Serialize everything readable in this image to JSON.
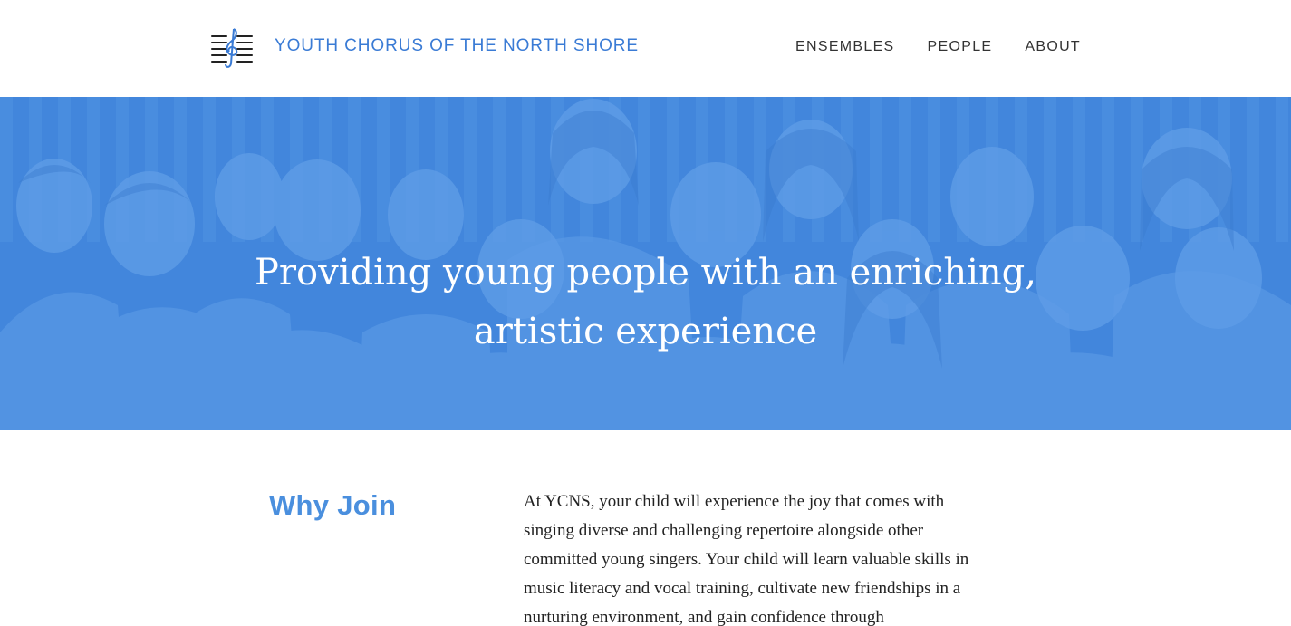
{
  "header": {
    "logo_icon": "treble-clef-staff-icon",
    "site_title": "YOUTH CHORUS OF THE NORTH SHORE",
    "nav": [
      {
        "label": "ENSEMBLES"
      },
      {
        "label": "PEOPLE"
      },
      {
        "label": "ABOUT"
      }
    ]
  },
  "hero": {
    "title_lines": [
      "Providing young people with an enriching,",
      "artistic experience"
    ]
  },
  "why_join": {
    "heading": "Why Join",
    "text_lines": [
      "At YCNS, your child will experience the joy that comes with",
      "singing diverse and challenging repertoire alongside other",
      "committed young singers. Your child will learn valuable skills in",
      "music literacy and vocal training, cultivate new friendships in a",
      "nurturing environment, and gain confidence through"
    ]
  },
  "colors": {
    "brand_blue": "#3a7bd5",
    "hero_tint": "#4b8ddf",
    "heading_blue": "#4a8fde"
  }
}
